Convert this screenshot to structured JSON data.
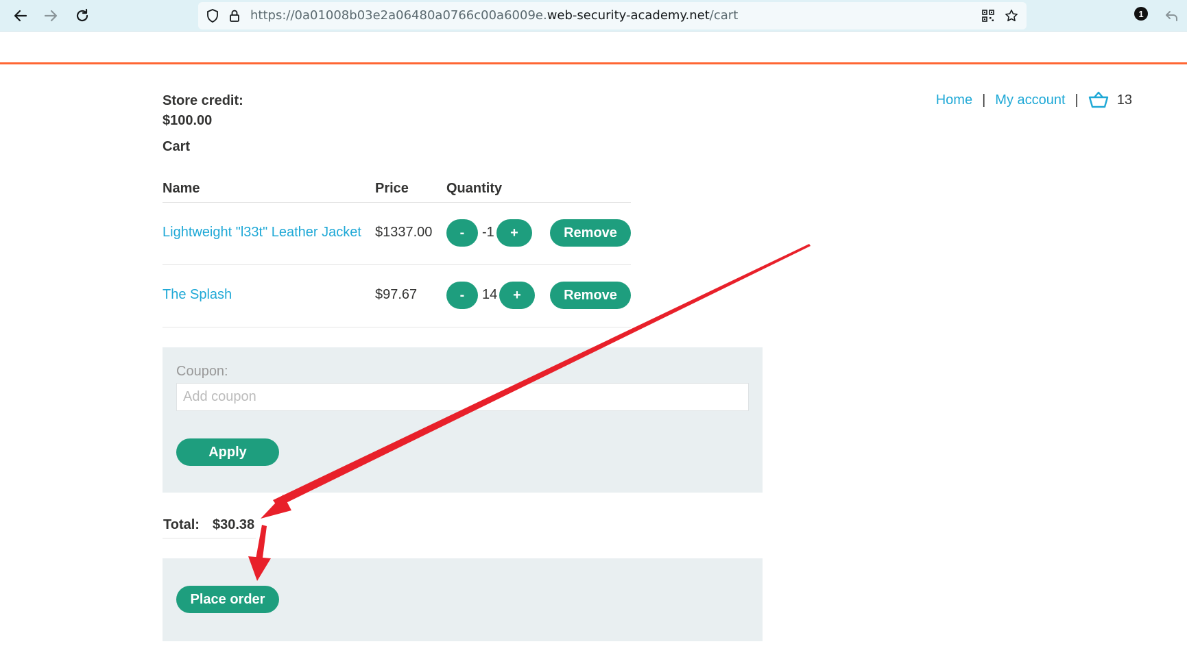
{
  "browser": {
    "url_prefix": "https://0a01008b03e2a06480a0766c00a6009e.",
    "url_host": "web-security-academy.net",
    "url_path": "/cart",
    "extension_badge": "1"
  },
  "nav": {
    "home": "Home",
    "my_account": "My account",
    "separator": "|",
    "cart_count": "13"
  },
  "store_credit": {
    "label": "Store credit:",
    "value": "$100.00"
  },
  "cart": {
    "title": "Cart",
    "headers": {
      "name": "Name",
      "price": "Price",
      "quantity": "Quantity"
    },
    "items": [
      {
        "name": "Lightweight \"l33t\" Leather Jacket",
        "price": "$1337.00",
        "qty": "-1",
        "minus": "-",
        "plus": "+",
        "remove": "Remove"
      },
      {
        "name": "The Splash",
        "price": "$97.67",
        "qty": "14",
        "minus": "-",
        "plus": "+",
        "remove": "Remove"
      }
    ]
  },
  "coupon": {
    "label": "Coupon:",
    "placeholder": "Add coupon",
    "apply": "Apply"
  },
  "total": {
    "label": "Total:",
    "value": "$30.38"
  },
  "order": {
    "place_order": "Place order"
  },
  "colors": {
    "accent_green": "#1e9e7e",
    "link_blue": "#1ea8d6",
    "header_orange": "#ff6633",
    "annotation_red": "#e8202a"
  }
}
